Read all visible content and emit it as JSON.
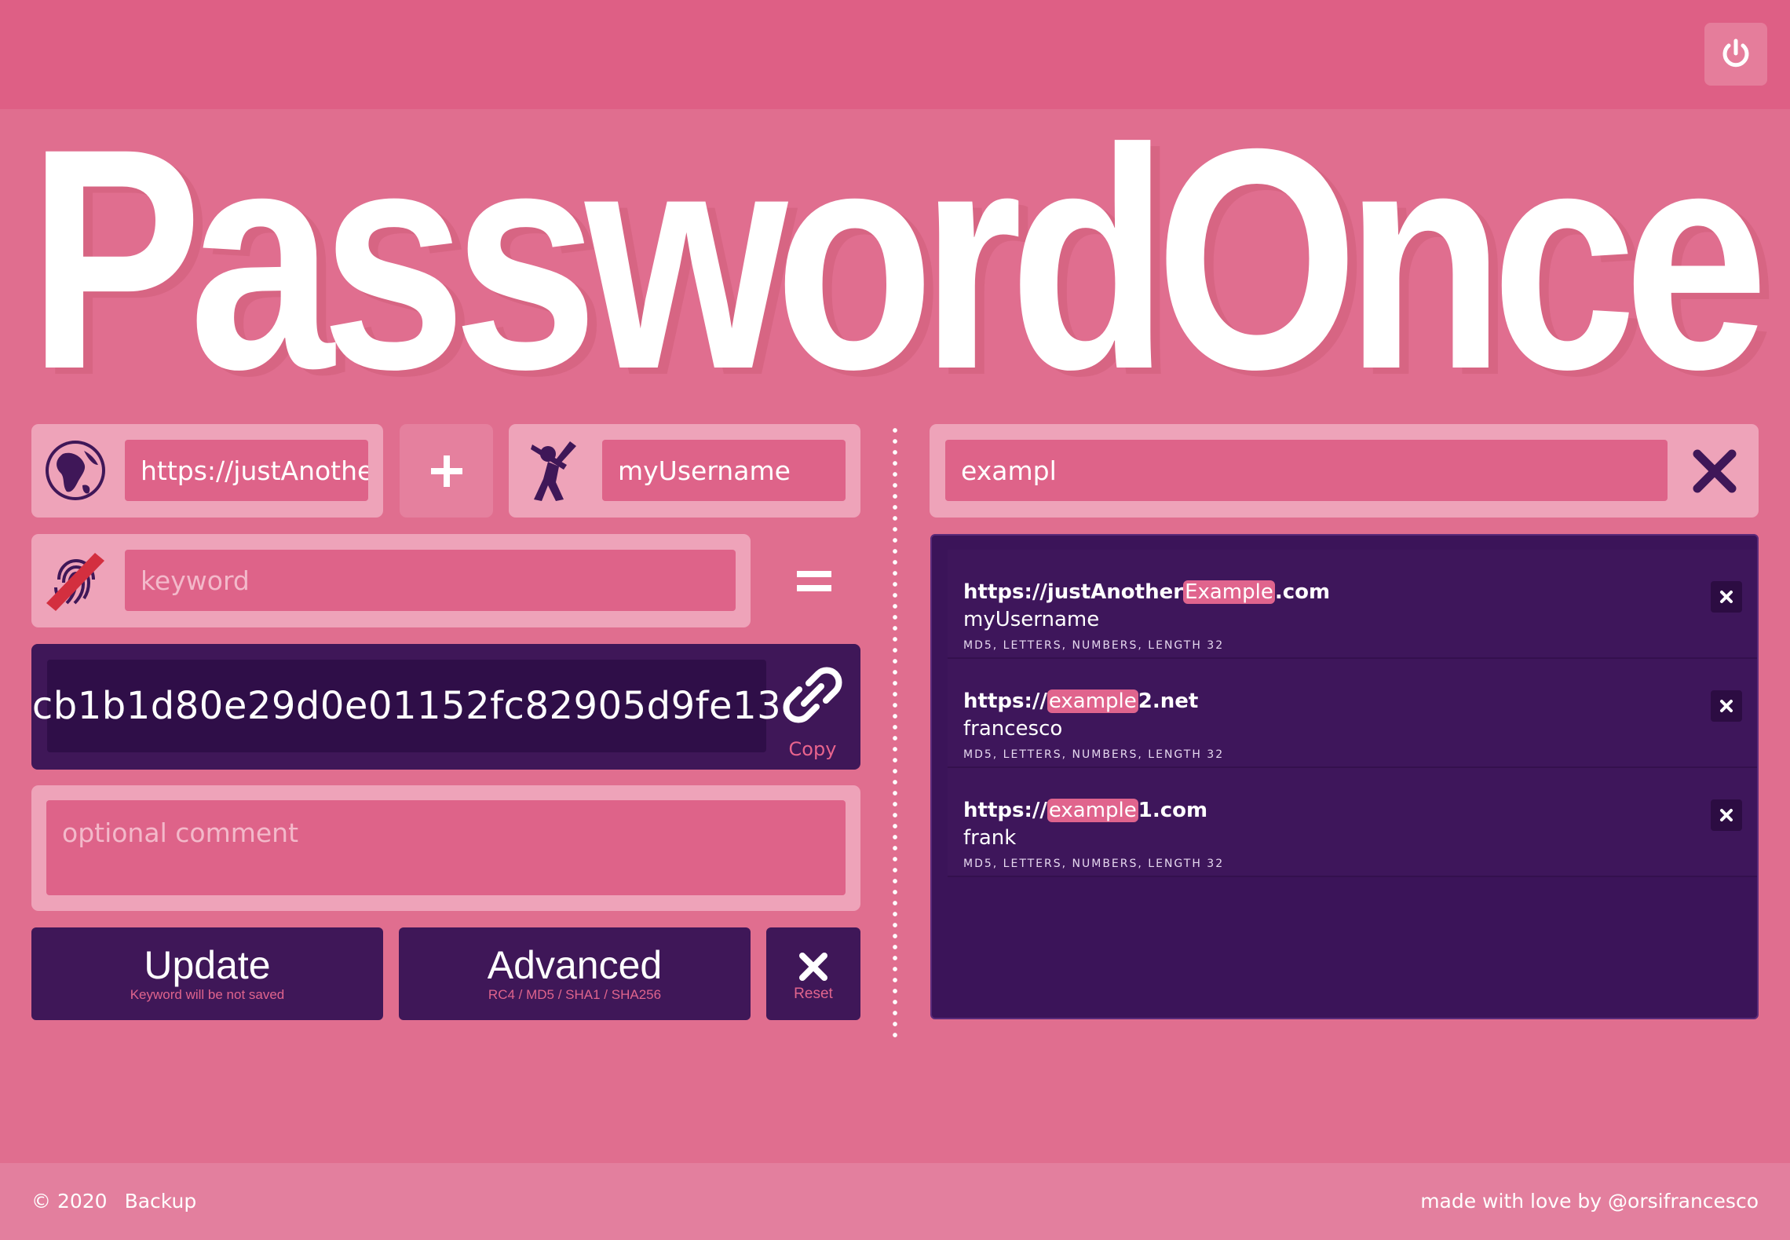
{
  "app": {
    "logo_text": "PasswordOnce"
  },
  "header": {
    "power_icon": "power-icon"
  },
  "form": {
    "site_value": "https://justAnotherExample.com",
    "site_display": "https://justAnothe",
    "username_value": "myUsername",
    "keyword_placeholder": "keyword",
    "plus_label": "+",
    "equals_label": "=",
    "password_output": "cb1b1d80e29d0e01152fc82905d9fe13",
    "copy_label": "Copy",
    "comment_placeholder": "optional comment"
  },
  "buttons": {
    "update_label": "Update",
    "update_sub": "Keyword will be not saved",
    "advanced_label": "Advanced",
    "advanced_sub": "RC4 / MD5 / SHA1 / SHA256",
    "reset_label": "Reset"
  },
  "search": {
    "value": "exampl"
  },
  "results": [
    {
      "url_pre": "https://justAnother",
      "url_hl": "Example",
      "url_post": ".com",
      "user": "myUsername",
      "meta": "MD5, LETTERS, NUMBERS, LENGTH 32"
    },
    {
      "url_pre": "https://",
      "url_hl": "example",
      "url_post": "2.net",
      "user": "francesco",
      "meta": "MD5, LETTERS, NUMBERS, LENGTH 32"
    },
    {
      "url_pre": "https://",
      "url_hl": "example",
      "url_post": "1.com",
      "user": "frank",
      "meta": "MD5, LETTERS, NUMBERS, LENGTH 32"
    }
  ],
  "footer": {
    "copyright": "© 2020",
    "backup_label": "Backup",
    "credit": "made with love by @orsifrancesco"
  },
  "colors": {
    "background": "#e06e8f",
    "accent_dark": "#3f1758",
    "accent_pink": "#de6389",
    "highlight": "#e0648d"
  }
}
